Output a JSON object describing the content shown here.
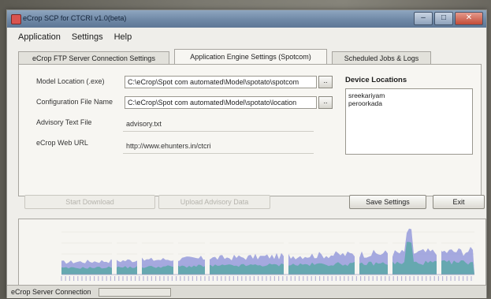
{
  "window": {
    "title": "eCrop SCP for CTCRI v1.0(beta)",
    "controls": {
      "minimize": "–",
      "maximize": "□",
      "close": "✕"
    }
  },
  "menu": [
    "Application",
    "Settings",
    "Help"
  ],
  "tabs": [
    {
      "label": "eCrop FTP Server Connection Settings",
      "active": false
    },
    {
      "label": "Application Engine Settings (Spotcom)",
      "active": true
    },
    {
      "label": "Scheduled Jobs & Logs",
      "active": false
    }
  ],
  "fields": {
    "model_location": {
      "label": "Model Location (.exe)",
      "value": "C:\\eCrop\\Spot com automated\\Model\\spotato\\spotcom",
      "browse": ".."
    },
    "config_file": {
      "label": "Configuration File Name",
      "value": "C:\\eCrop\\Spot com automated\\Model\\spotato\\location",
      "browse": ".."
    },
    "advisory_text": {
      "label": "Advisory Text File",
      "value": "advisory.txt"
    },
    "web_url": {
      "label": "eCrop Web URL",
      "value": "http://www.ehunters.in/ctcri"
    }
  },
  "device_locations": {
    "title": "Device Locations",
    "items": [
      "sreekariyam",
      "peroorkada"
    ]
  },
  "buttons": {
    "start_download": "Start Download",
    "upload_advisory": "Upload Advisory Data",
    "save_settings": "Save Settings",
    "exit": "Exit"
  },
  "status": {
    "text": "eCrop Server Connection"
  },
  "colors": {
    "title_bar": "#6f88a6",
    "window_bg": "#efeeea",
    "chart_fill_blue": "#8a8fd8",
    "chart_fill_teal": "#5aa8a8"
  }
}
